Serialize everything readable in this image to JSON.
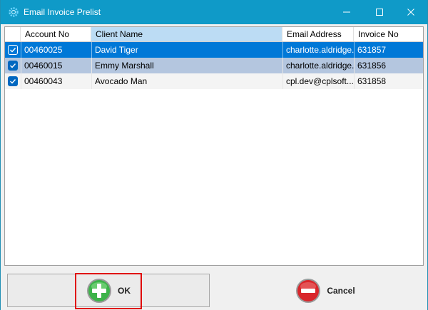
{
  "window": {
    "title": "Email Invoice Prelist"
  },
  "grid": {
    "columns": [
      "Account No",
      "Client Name",
      "Email Address",
      "Invoice No"
    ],
    "rows": [
      {
        "checked": true,
        "account_no": "00460025",
        "client_name": "David Tiger",
        "email": "charlotte.aldridge...",
        "invoice_no": "631857",
        "state": "selected"
      },
      {
        "checked": true,
        "account_no": "00460015",
        "client_name": "Emmy Marshall",
        "email": "charlotte.aldridge...",
        "invoice_no": "631856",
        "state": "highlighted"
      },
      {
        "checked": true,
        "account_no": "00460043",
        "client_name": "Avocado Man",
        "email": "cpl.dev@cplsoft...",
        "invoice_no": "631858",
        "state": "normal"
      }
    ]
  },
  "buttons": {
    "ok_label": "OK",
    "cancel_label": "Cancel"
  },
  "colors": {
    "titlebar": "#0f9ac8",
    "selection": "#0078d7",
    "ok_icon": "#3db34a",
    "cancel_icon": "#d9262b",
    "highlight_box": "#e00000"
  },
  "icons": {
    "app": "gear-icon",
    "ok": "plus-circle-icon",
    "cancel": "minus-circle-icon"
  }
}
